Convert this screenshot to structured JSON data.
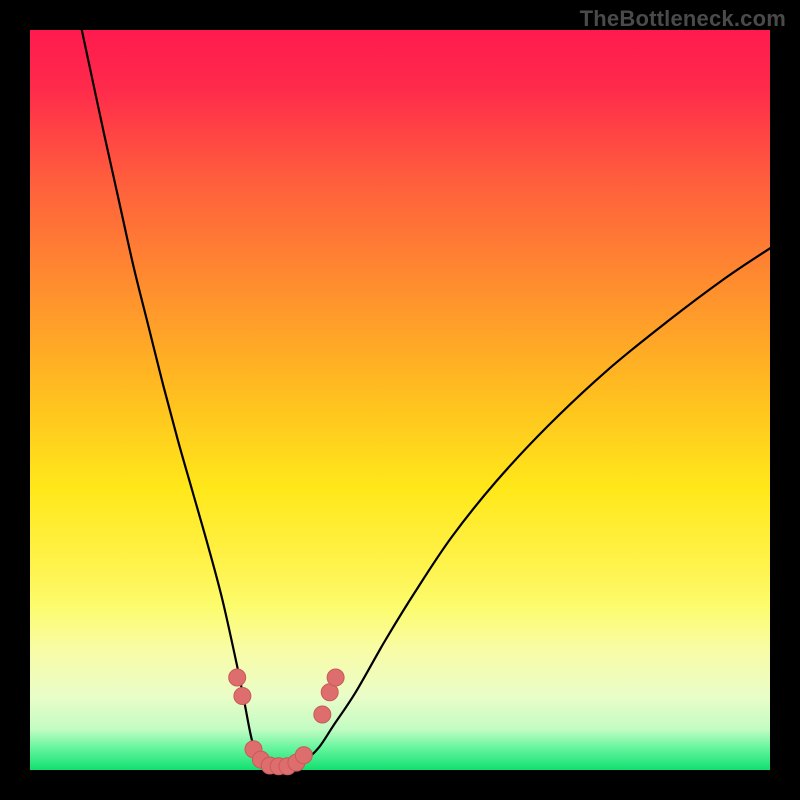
{
  "watermark": "TheBottleneck.com",
  "chart_data": {
    "type": "line",
    "title": "",
    "xlabel": "",
    "ylabel": "",
    "xlim": [
      0,
      100
    ],
    "ylim": [
      0,
      100
    ],
    "grid": false,
    "legend": false,
    "background_gradient_stops": [
      {
        "offset": 0.0,
        "color": "#ff1a4e"
      },
      {
        "offset": 0.08,
        "color": "#ff2b4b"
      },
      {
        "offset": 0.2,
        "color": "#ff5d3d"
      },
      {
        "offset": 0.35,
        "color": "#ff8f2e"
      },
      {
        "offset": 0.5,
        "color": "#ffc11f"
      },
      {
        "offset": 0.62,
        "color": "#ffe81a"
      },
      {
        "offset": 0.72,
        "color": "#fff24a"
      },
      {
        "offset": 0.78,
        "color": "#fcfc6e"
      },
      {
        "offset": 0.84,
        "color": "#f8fca8"
      },
      {
        "offset": 0.9,
        "color": "#eafdc8"
      },
      {
        "offset": 0.945,
        "color": "#c3fcc3"
      },
      {
        "offset": 0.97,
        "color": "#66f59e"
      },
      {
        "offset": 1.0,
        "color": "#11e070"
      }
    ],
    "series": [
      {
        "name": "bottleneck-curve",
        "x": [
          7.0,
          8.5,
          10.0,
          12.0,
          14.0,
          16.0,
          18.0,
          20.0,
          22.0,
          24.0,
          26.0,
          28.0,
          29.0,
          30.0,
          31.0,
          32.0,
          33.5,
          35.0,
          37.0,
          39.0,
          41.0,
          44.0,
          48.0,
          52.0,
          57.0,
          63.0,
          70.0,
          78.0,
          86.0,
          94.0,
          100.0
        ],
        "y": [
          100.0,
          93.0,
          86.0,
          77.0,
          68.0,
          60.0,
          52.0,
          44.5,
          37.5,
          30.5,
          23.0,
          14.0,
          9.0,
          4.0,
          1.5,
          0.4,
          0.2,
          0.4,
          1.2,
          3.0,
          6.0,
          10.5,
          17.5,
          24.0,
          31.5,
          39.0,
          46.5,
          54.0,
          60.5,
          66.5,
          70.5
        ]
      }
    ],
    "highlight_points": {
      "name": "near-minimum-markers",
      "color": "#de6e6e",
      "points": [
        {
          "x": 28.0,
          "y": 12.5
        },
        {
          "x": 28.7,
          "y": 10.0
        },
        {
          "x": 30.2,
          "y": 2.8
        },
        {
          "x": 31.2,
          "y": 1.4
        },
        {
          "x": 32.4,
          "y": 0.6
        },
        {
          "x": 33.6,
          "y": 0.5
        },
        {
          "x": 34.8,
          "y": 0.5
        },
        {
          "x": 36.0,
          "y": 1.0
        },
        {
          "x": 37.0,
          "y": 2.0
        },
        {
          "x": 39.5,
          "y": 7.5
        },
        {
          "x": 40.5,
          "y": 10.5
        },
        {
          "x": 41.3,
          "y": 12.5
        }
      ]
    }
  }
}
